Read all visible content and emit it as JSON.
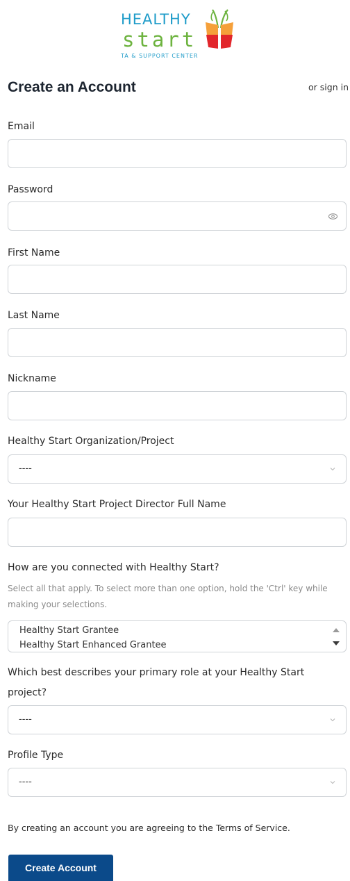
{
  "logo": {
    "line1": "HEALTHY",
    "line2": "start",
    "line3": "TA & SUPPORT CENTER"
  },
  "header": {
    "title": "Create an Account",
    "signin_link": "or sign in"
  },
  "form": {
    "email": {
      "label": "Email",
      "value": ""
    },
    "password": {
      "label": "Password",
      "value": "",
      "toggle_icon": "eye-icon"
    },
    "first_name": {
      "label": "First Name",
      "value": ""
    },
    "last_name": {
      "label": "Last Name",
      "value": ""
    },
    "nickname": {
      "label": "Nickname",
      "value": ""
    },
    "organization": {
      "label": "Healthy Start Organization/Project",
      "selected": "----"
    },
    "director": {
      "label": "Your Healthy Start Project Director Full Name",
      "value": ""
    },
    "connection": {
      "label": "How are you connected with Healthy Start?",
      "help": "Select all that apply. To select more than one option, hold the 'Ctrl' key while making your selections.",
      "options": [
        "Healthy Start Grantee",
        "Healthy Start Enhanced Grantee"
      ]
    },
    "role": {
      "label": "Which best describes your primary role at your Healthy Start project?",
      "selected": "----"
    },
    "profile_type": {
      "label": "Profile Type",
      "selected": "----"
    },
    "terms": "By creating an account you are agreeing to the Terms of Service.",
    "submit_label": "Create Account"
  },
  "colors": {
    "brand_blue": "#1f9cc9",
    "brand_green": "#6db33f",
    "brand_red": "#e2262b",
    "brand_orange": "#f5a03a",
    "button_blue": "#0b4a8a",
    "input_border": "#cfd3d7"
  }
}
